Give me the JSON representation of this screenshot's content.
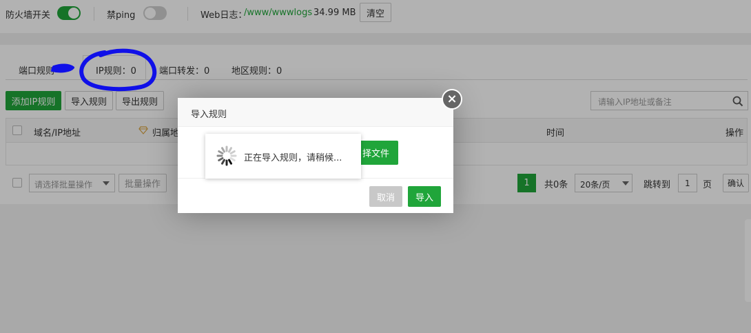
{
  "topbar": {
    "firewall_label": "防火墙开关",
    "ping_label": "禁ping",
    "weblog_label": "Web日志：",
    "weblog_path": "/www/wwwlogs",
    "weblog_size": "34.99 MB",
    "clear_button": "清空"
  },
  "tabs": [
    {
      "label": "端口规则"
    },
    {
      "label": "IP规则：0"
    },
    {
      "label": "端口转发：0"
    },
    {
      "label": "地区规则：0"
    }
  ],
  "toolbar": {
    "add_ip_rule": "添加IP规则",
    "import_rules": "导入规则",
    "export_rules": "导出规则",
    "search_placeholder": "请输入IP地址或备注"
  },
  "table": {
    "columns": [
      "域名/IP地址",
      "归属地",
      "时间",
      "操作"
    ]
  },
  "bottom": {
    "batch_select_placeholder": "请选择批量操作",
    "batch_button": "批量操作",
    "current_page": "1",
    "total": "共0条",
    "page_size": "20条/页",
    "goto_label": "跳转到",
    "goto_value": "1",
    "page_unit": "页",
    "confirm": "确认"
  },
  "modal": {
    "title": "导入规则",
    "close": "×",
    "choose_file_partial": "择文件",
    "cancel": "取消",
    "import": "导入"
  },
  "loading": {
    "text": "正在导入规则，请稍候..."
  },
  "colors": {
    "accent": "#20a53a",
    "annotation": "#1010e8"
  },
  "icons": {
    "search": "magnifier",
    "spinner": "loading-spinner",
    "close": "x-circle",
    "location": "diamond-outline"
  }
}
